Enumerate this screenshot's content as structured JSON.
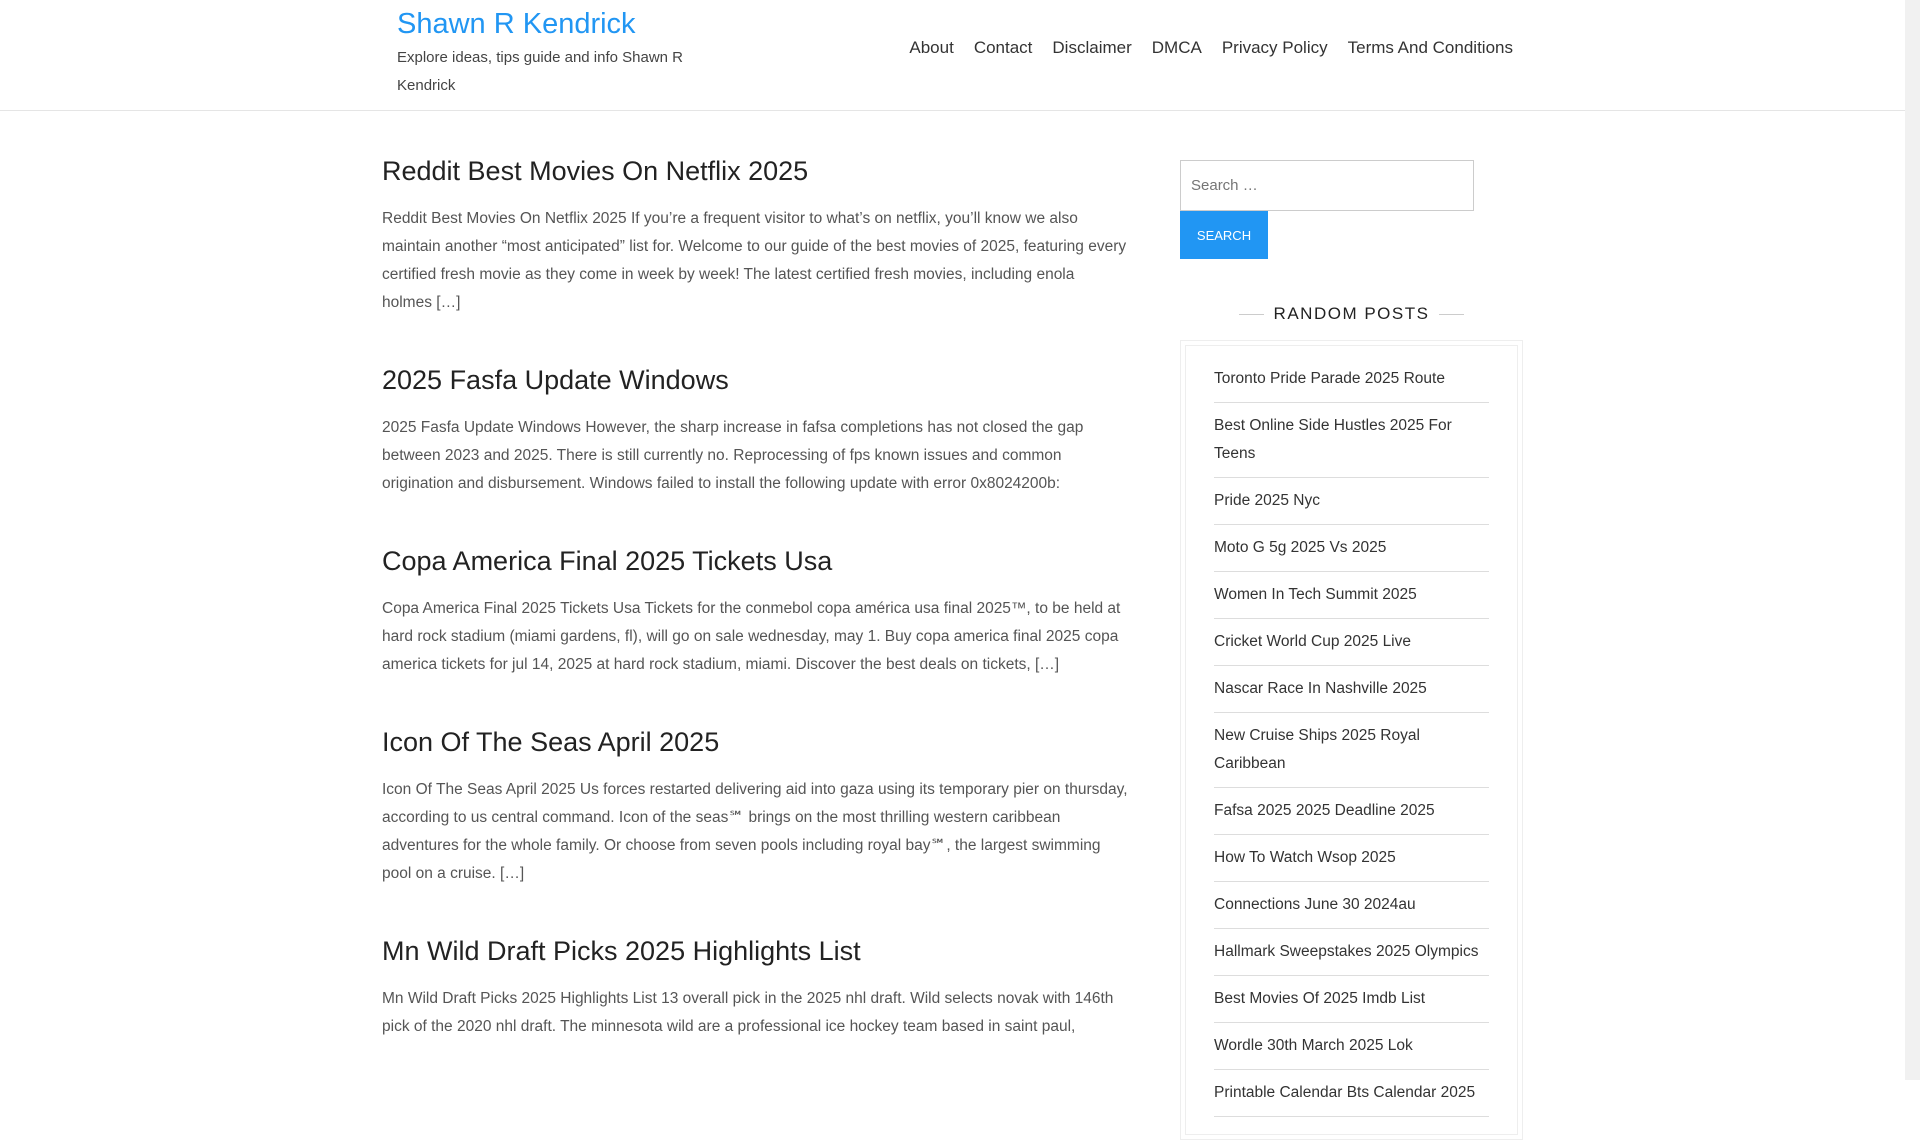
{
  "header": {
    "site_title": "Shawn R Kendrick",
    "tagline": "Explore ideas, tips guide and info Shawn R Kendrick",
    "nav": [
      "About",
      "Contact",
      "Disclaimer",
      "DMCA",
      "Privacy Policy",
      "Terms And Conditions"
    ]
  },
  "posts": [
    {
      "title": "Reddit Best Movies On Netflix 2025",
      "excerpt": "Reddit Best Movies On Netflix 2025 If you’re a frequent visitor to what’s on netflix, you’ll know we also maintain another “most anticipated” list for. Welcome to our guide of the best movies of 2025, featuring every certified fresh movie as they come in week by week! The latest certified fresh movies, including enola holmes […]"
    },
    {
      "title": "2025 Fasfa Update Windows",
      "excerpt": "2025 Fasfa Update Windows However, the sharp increase in fafsa completions has not closed the gap between 2023 and 2025. There is still currently no. Reprocessing of fps known issues and common origination and disbursement. Windows failed to install the following update with error 0x8024200b:"
    },
    {
      "title": "Copa America Final 2025 Tickets Usa",
      "excerpt": "Copa America Final 2025 Tickets Usa Tickets for the conmebol copa américa usa final 2025™, to be held at hard rock stadium (miami gardens, fl), will go on sale wednesday, may 1. Buy copa america final 2025 copa america tickets for jul 14, 2025 at hard rock stadium, miami. Discover the best deals on tickets, […]"
    },
    {
      "title": "Icon Of The Seas April 2025",
      "excerpt": "Icon Of The Seas April 2025 Us forces restarted delivering aid into gaza using its temporary pier on thursday, according to us central command. Icon of the seas℠ brings on the most thrilling western caribbean adventures for the whole family. Or choose from seven pools including royal bay℠, the largest swimming pool on a cruise. […]"
    },
    {
      "title": "Mn Wild Draft Picks 2025 Highlights List",
      "excerpt": "Mn Wild Draft Picks 2025 Highlights List 13 overall pick in the 2025 nhl draft. Wild selects novak with 146th pick of the 2020 nhl draft. The minnesota wild are a professional ice hockey team based in saint paul,"
    }
  ],
  "sidebar": {
    "search_placeholder": "Search …",
    "search_button": "SEARCH",
    "widget_title": "RANDOM POSTS",
    "random_posts": [
      "Toronto Pride Parade 2025 Route",
      "Best Online Side Hustles 2025 For Teens",
      "Pride 2025 Nyc",
      "Moto G 5g 2025 Vs 2025",
      "Women In Tech Summit 2025",
      "Cricket World Cup 2025 Live",
      "Nascar Race In Nashville 2025",
      "New Cruise Ships 2025 Royal Caribbean",
      "Fafsa 2025 2025 Deadline 2025",
      "How To Watch Wsop 2025",
      "Connections June 30 2024au",
      "Hallmark Sweepstakes 2025 Olympics",
      "Best Movies Of 2025 Imdb List",
      "Wordle 30th March 2025 Lok",
      "Printable Calendar Bts Calendar 2025"
    ]
  }
}
